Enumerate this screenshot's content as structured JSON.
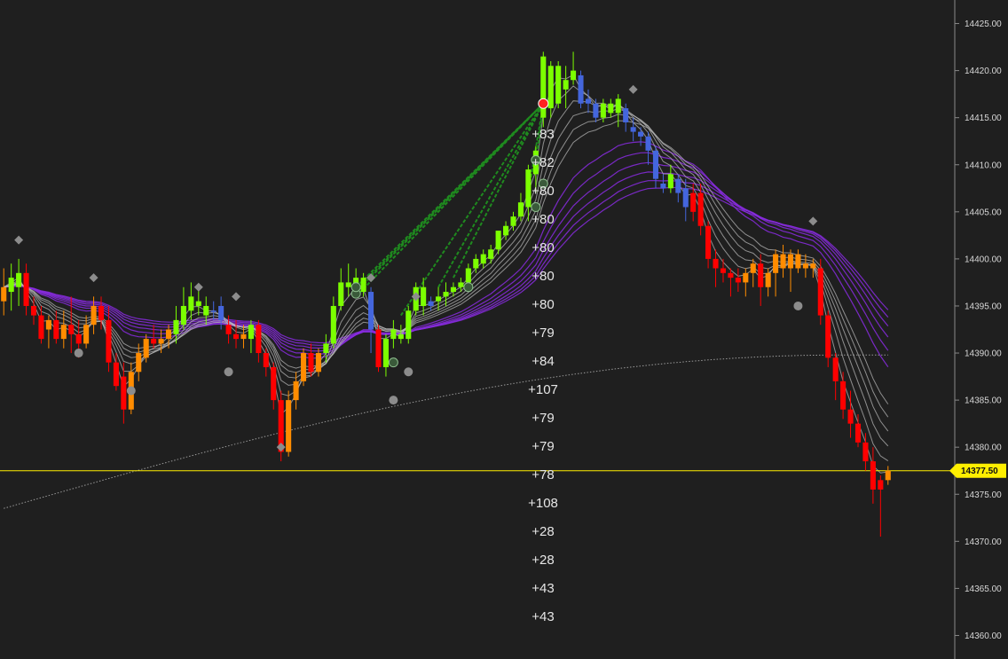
{
  "chart_data": {
    "type": "candlestick",
    "y_axis": {
      "side": "right",
      "ylim": [
        14357.5,
        14427.5
      ],
      "ticks": [
        14425,
        14420,
        14415,
        14410,
        14405,
        14400,
        14395,
        14390,
        14385,
        14380,
        14375,
        14370,
        14365,
        14360
      ],
      "tick_labels": [
        "14425.00",
        "14420.00",
        "14415.00",
        "14410.00",
        "14405.00",
        "14400.00",
        "14395.00",
        "14390.00",
        "14385.00",
        "14380.00",
        "14375.00",
        "14370.00",
        "14365.00",
        "14360.00"
      ]
    },
    "last_price": {
      "value": 14377.5,
      "label": "14377.50",
      "color": "#ffef00"
    },
    "colors": {
      "background": "#1f1f1f",
      "up_strong": "#7cff00",
      "up": "#ff8c00",
      "down_strong": "#ff0000",
      "neutral": "#4466dd",
      "axis": "#888888",
      "slow_ribbon": "#8a2be2",
      "fast_ribbon": "#bfbfbf",
      "long_ma": "#9a9a9a",
      "markers": "#8c8c8c",
      "trade_lines": "#1f8a1f",
      "entry_dot": "#ff2020"
    },
    "annotation_labels": [
      "+83",
      "+82",
      "+80",
      "+80",
      "+80",
      "+80",
      "+80",
      "+79",
      "+84",
      "+107",
      "+79",
      "+79",
      "+78",
      "+108",
      "+28",
      "+28",
      "+43",
      "+43"
    ],
    "candles": [
      {
        "o": 14395.5,
        "h": 14399,
        "l": 14394,
        "c": 14397,
        "col": "orange"
      },
      {
        "o": 14396.5,
        "h": 14399.5,
        "l": 14394.5,
        "c": 14398,
        "col": "green"
      },
      {
        "o": 14397,
        "h": 14400,
        "l": 14395,
        "c": 14398.5,
        "col": "green"
      },
      {
        "o": 14398.5,
        "h": 14399.5,
        "l": 14394,
        "c": 14395,
        "col": "red"
      },
      {
        "o": 14395,
        "h": 14396,
        "l": 14393,
        "c": 14394,
        "col": "red"
      },
      {
        "o": 14394,
        "h": 14395,
        "l": 14391,
        "c": 14391.5,
        "col": "red"
      },
      {
        "o": 14392.5,
        "h": 14394,
        "l": 14390.5,
        "c": 14393.5,
        "col": "orange"
      },
      {
        "o": 14393.5,
        "h": 14394.5,
        "l": 14391,
        "c": 14391.5,
        "col": "red"
      },
      {
        "o": 14391.5,
        "h": 14394.5,
        "l": 14390.5,
        "c": 14393,
        "col": "orange"
      },
      {
        "o": 14393,
        "h": 14396,
        "l": 14390,
        "c": 14392,
        "col": "red"
      },
      {
        "o": 14392,
        "h": 14393.5,
        "l": 14389.5,
        "c": 14391,
        "col": "red"
      },
      {
        "o": 14391,
        "h": 14394,
        "l": 14390.5,
        "c": 14393,
        "col": "orange"
      },
      {
        "o": 14393,
        "h": 14396,
        "l": 14392,
        "c": 14395,
        "col": "orange"
      },
      {
        "o": 14395,
        "h": 14396,
        "l": 14392.5,
        "c": 14393.5,
        "col": "red"
      },
      {
        "o": 14393.5,
        "h": 14395,
        "l": 14388,
        "c": 14389,
        "col": "red"
      },
      {
        "o": 14389,
        "h": 14390,
        "l": 14386,
        "c": 14386.5,
        "col": "red"
      },
      {
        "o": 14387.5,
        "h": 14389,
        "l": 14382.5,
        "c": 14384,
        "col": "red"
      },
      {
        "o": 14384,
        "h": 14389,
        "l": 14383.5,
        "c": 14388,
        "col": "orange"
      },
      {
        "o": 14388,
        "h": 14391,
        "l": 14387,
        "c": 14390,
        "col": "orange"
      },
      {
        "o": 14389.5,
        "h": 14392,
        "l": 14389,
        "c": 14391.5,
        "col": "orange"
      },
      {
        "o": 14391.5,
        "h": 14393,
        "l": 14390.5,
        "c": 14391,
        "col": "red"
      },
      {
        "o": 14391,
        "h": 14392.5,
        "l": 14390,
        "c": 14391.5,
        "col": "orange"
      },
      {
        "o": 14391.5,
        "h": 14393,
        "l": 14390.5,
        "c": 14392.5,
        "col": "orange"
      },
      {
        "o": 14392,
        "h": 14395,
        "l": 14391,
        "c": 14393.5,
        "col": "green"
      },
      {
        "o": 14393,
        "h": 14397,
        "l": 14392.5,
        "c": 14395,
        "col": "green"
      },
      {
        "o": 14394.5,
        "h": 14397.5,
        "l": 14393.5,
        "c": 14396,
        "col": "green"
      },
      {
        "o": 14395.5,
        "h": 14397,
        "l": 14394,
        "c": 14395,
        "col": "green"
      },
      {
        "o": 14395,
        "h": 14396,
        "l": 14393,
        "c": 14394,
        "col": "green"
      },
      {
        "o": 14394.5,
        "h": 14395.5,
        "l": 14393.5,
        "c": 14394.5,
        "col": "blue"
      },
      {
        "o": 14395,
        "h": 14396,
        "l": 14392.5,
        "c": 14393.5,
        "col": "blue"
      },
      {
        "o": 14393,
        "h": 14394,
        "l": 14391,
        "c": 14392,
        "col": "red"
      },
      {
        "o": 14392,
        "h": 14393.5,
        "l": 14390.5,
        "c": 14391.5,
        "col": "red"
      },
      {
        "o": 14391.5,
        "h": 14393,
        "l": 14390.5,
        "c": 14392,
        "col": "orange"
      },
      {
        "o": 14391.5,
        "h": 14393.5,
        "l": 14390,
        "c": 14393,
        "col": "green"
      },
      {
        "o": 14393,
        "h": 14393.5,
        "l": 14389,
        "c": 14390,
        "col": "red"
      },
      {
        "o": 14390,
        "h": 14390.5,
        "l": 14387.5,
        "c": 14388.5,
        "col": "red"
      },
      {
        "o": 14388.5,
        "h": 14389,
        "l": 14384,
        "c": 14385,
        "col": "red"
      },
      {
        "o": 14385,
        "h": 14386,
        "l": 14378.5,
        "c": 14379.5,
        "col": "red"
      },
      {
        "o": 14379.5,
        "h": 14386,
        "l": 14379,
        "c": 14385,
        "col": "orange"
      },
      {
        "o": 14385,
        "h": 14388,
        "l": 14384,
        "c": 14387,
        "col": "orange"
      },
      {
        "o": 14387,
        "h": 14390.5,
        "l": 14386.5,
        "c": 14390,
        "col": "orange"
      },
      {
        "o": 14390,
        "h": 14391,
        "l": 14387.5,
        "c": 14388,
        "col": "red"
      },
      {
        "o": 14388,
        "h": 14390.5,
        "l": 14387.5,
        "c": 14390,
        "col": "orange"
      },
      {
        "o": 14390,
        "h": 14392,
        "l": 14389,
        "c": 14391,
        "col": "green"
      },
      {
        "o": 14391,
        "h": 14396,
        "l": 14390.5,
        "c": 14395,
        "col": "green"
      },
      {
        "o": 14395,
        "h": 14399,
        "l": 14394.5,
        "c": 14397.5,
        "col": "green"
      },
      {
        "o": 14397.5,
        "h": 14399.5,
        "l": 14396,
        "c": 14397,
        "col": "green"
      },
      {
        "o": 14397,
        "h": 14399,
        "l": 14396,
        "c": 14398,
        "col": "green"
      },
      {
        "o": 14398,
        "h": 14398.5,
        "l": 14396,
        "c": 14396.5,
        "col": "green"
      },
      {
        "o": 14396.5,
        "h": 14397,
        "l": 14390,
        "c": 14392.5,
        "col": "blue"
      },
      {
        "o": 14392.5,
        "h": 14393,
        "l": 14388,
        "c": 14388.5,
        "col": "red"
      },
      {
        "o": 14388.5,
        "h": 14392,
        "l": 14387.5,
        "c": 14391.5,
        "col": "green"
      },
      {
        "o": 14391.5,
        "h": 14393.5,
        "l": 14390.5,
        "c": 14392.5,
        "col": "green"
      },
      {
        "o": 14392,
        "h": 14393,
        "l": 14391,
        "c": 14391.5,
        "col": "green"
      },
      {
        "o": 14391.5,
        "h": 14395,
        "l": 14391,
        "c": 14394.5,
        "col": "green"
      },
      {
        "o": 14394.5,
        "h": 14397.5,
        "l": 14394,
        "c": 14397,
        "col": "green"
      },
      {
        "o": 14397,
        "h": 14398,
        "l": 14394,
        "c": 14395,
        "col": "green"
      },
      {
        "o": 14395,
        "h": 14396,
        "l": 14394.5,
        "c": 14395.5,
        "col": "blue"
      },
      {
        "o": 14395.5,
        "h": 14397,
        "l": 14394.5,
        "c": 14396,
        "col": "green"
      },
      {
        "o": 14396,
        "h": 14397.5,
        "l": 14395,
        "c": 14396.5,
        "col": "green"
      },
      {
        "o": 14396.5,
        "h": 14397.5,
        "l": 14396,
        "c": 14397,
        "col": "green"
      },
      {
        "o": 14397,
        "h": 14398,
        "l": 14396.5,
        "c": 14397.5,
        "col": "green"
      },
      {
        "o": 14397.5,
        "h": 14399.5,
        "l": 14397,
        "c": 14399,
        "col": "green"
      },
      {
        "o": 14399,
        "h": 14400.5,
        "l": 14398.5,
        "c": 14400,
        "col": "green"
      },
      {
        "o": 14399.5,
        "h": 14401,
        "l": 14399,
        "c": 14400.5,
        "col": "green"
      },
      {
        "o": 14400,
        "h": 14401.5,
        "l": 14399.5,
        "c": 14401,
        "col": "green"
      },
      {
        "o": 14401,
        "h": 14403,
        "l": 14400.5,
        "c": 14403,
        "col": "green"
      },
      {
        "o": 14402.5,
        "h": 14404,
        "l": 14402,
        "c": 14403.5,
        "col": "green"
      },
      {
        "o": 14403.5,
        "h": 14405,
        "l": 14403,
        "c": 14404.5,
        "col": "green"
      },
      {
        "o": 14404.5,
        "h": 14407,
        "l": 14404,
        "c": 14406,
        "col": "green"
      },
      {
        "o": 14405.5,
        "h": 14410,
        "l": 14404,
        "c": 14409.5,
        "col": "green"
      },
      {
        "o": 14409,
        "h": 14412,
        "l": 14407,
        "c": 14411.5,
        "col": "green"
      },
      {
        "o": 14415,
        "h": 14422,
        "l": 14414,
        "c": 14421.5,
        "col": "green"
      },
      {
        "o": 14416,
        "h": 14421,
        "l": 14415,
        "c": 14420.5,
        "col": "green"
      },
      {
        "o": 14416.5,
        "h": 14421,
        "l": 14416,
        "c": 14420.5,
        "col": "green"
      },
      {
        "o": 14418,
        "h": 14420.5,
        "l": 14416,
        "c": 14419,
        "col": "green"
      },
      {
        "o": 14419,
        "h": 14422,
        "l": 14418.5,
        "c": 14420,
        "col": "green"
      },
      {
        "o": 14419.5,
        "h": 14420,
        "l": 14416,
        "c": 14416.5,
        "col": "blue"
      },
      {
        "o": 14417,
        "h": 14418,
        "l": 14415.5,
        "c": 14416.5,
        "col": "blue"
      },
      {
        "o": 14416.5,
        "h": 14417,
        "l": 14414.5,
        "c": 14415,
        "col": "blue"
      },
      {
        "o": 14415,
        "h": 14417,
        "l": 14414.5,
        "c": 14416.5,
        "col": "green"
      },
      {
        "o": 14416.5,
        "h": 14417,
        "l": 14415,
        "c": 14415.5,
        "col": "green"
      },
      {
        "o": 14415.5,
        "h": 14417.5,
        "l": 14414,
        "c": 14417,
        "col": "green"
      },
      {
        "o": 14416,
        "h": 14416.5,
        "l": 14413.5,
        "c": 14414.5,
        "col": "blue"
      },
      {
        "o": 14414,
        "h": 14415,
        "l": 14412.5,
        "c": 14413.5,
        "col": "blue"
      },
      {
        "o": 14413.5,
        "h": 14414,
        "l": 14412,
        "c": 14413,
        "col": "blue"
      },
      {
        "o": 14413,
        "h": 14413.5,
        "l": 14410,
        "c": 14411.5,
        "col": "blue"
      },
      {
        "o": 14411.5,
        "h": 14412,
        "l": 14407.5,
        "c": 14408.5,
        "col": "blue"
      },
      {
        "o": 14408,
        "h": 14409,
        "l": 14407,
        "c": 14407.5,
        "col": "blue"
      },
      {
        "o": 14407.5,
        "h": 14410,
        "l": 14407,
        "c": 14409,
        "col": "green"
      },
      {
        "o": 14408.5,
        "h": 14409,
        "l": 14406,
        "c": 14407,
        "col": "blue"
      },
      {
        "o": 14407.5,
        "h": 14408.5,
        "l": 14404,
        "c": 14405.5,
        "col": "blue"
      },
      {
        "o": 14405,
        "h": 14408,
        "l": 14404,
        "c": 14407,
        "col": "red"
      },
      {
        "o": 14407,
        "h": 14408,
        "l": 14402.5,
        "c": 14403.5,
        "col": "red"
      },
      {
        "o": 14403.5,
        "h": 14404,
        "l": 14399,
        "c": 14400,
        "col": "red"
      },
      {
        "o": 14400,
        "h": 14401,
        "l": 14397,
        "c": 14399,
        "col": "red"
      },
      {
        "o": 14399,
        "h": 14400,
        "l": 14397.5,
        "c": 14398.5,
        "col": "red"
      },
      {
        "o": 14398.5,
        "h": 14399,
        "l": 14396,
        "c": 14398,
        "col": "red"
      },
      {
        "o": 14398,
        "h": 14399,
        "l": 14396.5,
        "c": 14397.5,
        "col": "red"
      },
      {
        "o": 14397.5,
        "h": 14399,
        "l": 14396,
        "c": 14398.5,
        "col": "orange"
      },
      {
        "o": 14398.5,
        "h": 14400,
        "l": 14397,
        "c": 14399.5,
        "col": "orange"
      },
      {
        "o": 14399.5,
        "h": 14400.5,
        "l": 14395,
        "c": 14397,
        "col": "red"
      },
      {
        "o": 14397,
        "h": 14399,
        "l": 14396,
        "c": 14398.5,
        "col": "orange"
      },
      {
        "o": 14398.5,
        "h": 14401,
        "l": 14396,
        "c": 14400.5,
        "col": "orange"
      },
      {
        "o": 14400.5,
        "h": 14401.5,
        "l": 14398,
        "c": 14399,
        "col": "orange"
      },
      {
        "o": 14399,
        "h": 14401,
        "l": 14396.5,
        "c": 14400.5,
        "col": "orange"
      },
      {
        "o": 14400.5,
        "h": 14401,
        "l": 14398.5,
        "c": 14399,
        "col": "orange"
      },
      {
        "o": 14399,
        "h": 14400.5,
        "l": 14398,
        "c": 14399.5,
        "col": "orange"
      },
      {
        "o": 14399.5,
        "h": 14400,
        "l": 14398,
        "c": 14399,
        "col": "orange"
      },
      {
        "o": 14399,
        "h": 14400,
        "l": 14393,
        "c": 14394,
        "col": "red"
      },
      {
        "o": 14394,
        "h": 14394.5,
        "l": 14388.5,
        "c": 14389.5,
        "col": "red"
      },
      {
        "o": 14389.5,
        "h": 14390,
        "l": 14385,
        "c": 14387,
        "col": "red"
      },
      {
        "o": 14387,
        "h": 14388,
        "l": 14383,
        "c": 14384,
        "col": "red"
      },
      {
        "o": 14384,
        "h": 14386,
        "l": 14381,
        "c": 14382.5,
        "col": "red"
      },
      {
        "o": 14382.5,
        "h": 14383.5,
        "l": 14380,
        "c": 14380.5,
        "col": "red"
      },
      {
        "o": 14380.5,
        "h": 14381.5,
        "l": 14377.5,
        "c": 14378.5,
        "col": "red"
      },
      {
        "o": 14378.5,
        "h": 14380,
        "l": 14374,
        "c": 14375.5,
        "col": "red"
      },
      {
        "o": 14375.5,
        "h": 14377,
        "l": 14370.5,
        "c": 14376.5,
        "col": "red"
      },
      {
        "o": 14376.5,
        "h": 14378,
        "l": 14376,
        "c": 14377.5,
        "col": "orange"
      }
    ]
  }
}
